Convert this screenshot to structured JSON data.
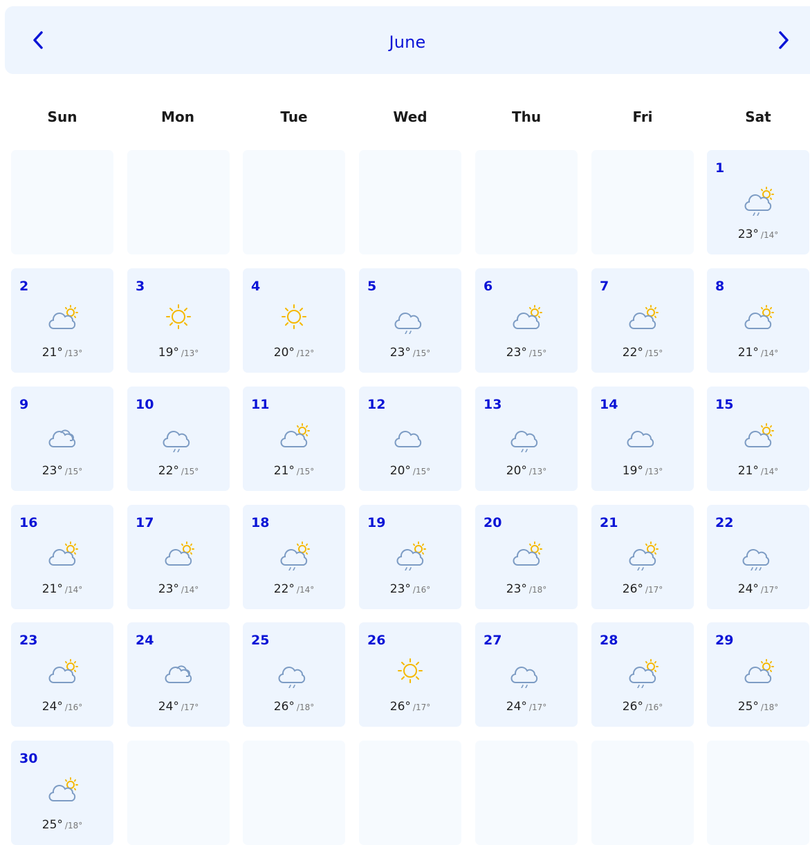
{
  "header": {
    "month": "June",
    "prev_icon": "chevron-left-icon",
    "next_icon": "chevron-right-icon",
    "accent": "#0b14d6",
    "header_bg": "#eef5fe"
  },
  "weekdays": [
    "Sun",
    "Mon",
    "Tue",
    "Wed",
    "Thu",
    "Fri",
    "Sat"
  ],
  "leading_blanks": 6,
  "total_cells": 42,
  "days": [
    {
      "day": "1",
      "icon": "partly-cloudy-rain",
      "high": "23°",
      "low": "/14°"
    },
    {
      "day": "2",
      "icon": "partly-cloudy",
      "high": "21°",
      "low": "/13°"
    },
    {
      "day": "3",
      "icon": "sunny",
      "high": "19°",
      "low": "/13°"
    },
    {
      "day": "4",
      "icon": "sunny",
      "high": "20°",
      "low": "/12°"
    },
    {
      "day": "5",
      "icon": "light-rain",
      "high": "23°",
      "low": "/15°"
    },
    {
      "day": "6",
      "icon": "partly-cloudy",
      "high": "23°",
      "low": "/15°"
    },
    {
      "day": "7",
      "icon": "partly-cloudy",
      "high": "22°",
      "low": "/15°"
    },
    {
      "day": "8",
      "icon": "partly-cloudy",
      "high": "21°",
      "low": "/14°"
    },
    {
      "day": "9",
      "icon": "overcast",
      "high": "23°",
      "low": "/15°"
    },
    {
      "day": "10",
      "icon": "light-rain",
      "high": "22°",
      "low": "/15°"
    },
    {
      "day": "11",
      "icon": "partly-cloudy",
      "high": "21°",
      "low": "/15°"
    },
    {
      "day": "12",
      "icon": "cloudy",
      "high": "20°",
      "low": "/15°"
    },
    {
      "day": "13",
      "icon": "light-rain",
      "high": "20°",
      "low": "/13°"
    },
    {
      "day": "14",
      "icon": "cloudy",
      "high": "19°",
      "low": "/13°"
    },
    {
      "day": "15",
      "icon": "partly-cloudy",
      "high": "21°",
      "low": "/14°"
    },
    {
      "day": "16",
      "icon": "partly-cloudy",
      "high": "21°",
      "low": "/14°"
    },
    {
      "day": "17",
      "icon": "partly-cloudy",
      "high": "23°",
      "low": "/14°"
    },
    {
      "day": "18",
      "icon": "partly-cloudy-rain",
      "high": "22°",
      "low": "/14°"
    },
    {
      "day": "19",
      "icon": "partly-cloudy-rain",
      "high": "23°",
      "low": "/16°"
    },
    {
      "day": "20",
      "icon": "partly-cloudy",
      "high": "23°",
      "low": "/18°"
    },
    {
      "day": "21",
      "icon": "partly-cloudy-rain",
      "high": "26°",
      "low": "/17°"
    },
    {
      "day": "22",
      "icon": "rain",
      "high": "24°",
      "low": "/17°"
    },
    {
      "day": "23",
      "icon": "partly-cloudy",
      "high": "24°",
      "low": "/16°"
    },
    {
      "day": "24",
      "icon": "overcast",
      "high": "24°",
      "low": "/17°"
    },
    {
      "day": "25",
      "icon": "light-rain",
      "high": "26°",
      "low": "/18°"
    },
    {
      "day": "26",
      "icon": "sunny",
      "high": "26°",
      "low": "/17°"
    },
    {
      "day": "27",
      "icon": "light-rain",
      "high": "24°",
      "low": "/17°"
    },
    {
      "day": "28",
      "icon": "partly-cloudy-rain",
      "high": "26°",
      "low": "/16°"
    },
    {
      "day": "29",
      "icon": "partly-cloudy",
      "high": "25°",
      "low": "/18°"
    },
    {
      "day": "30",
      "icon": "partly-cloudy",
      "high": "25°",
      "low": "/18°"
    }
  ],
  "colors": {
    "cloud": "#7d9cc4",
    "sun": "#f5b800",
    "day_number": "#0b14d6",
    "cell_bg": "#eef5fe",
    "empty_cell_bg": "#f6fafe"
  }
}
